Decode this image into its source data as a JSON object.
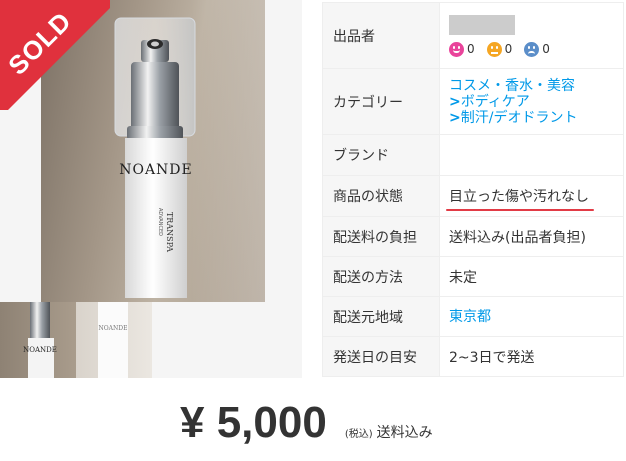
{
  "gallery": {
    "sold_badge": "SOLD",
    "bottle_brand": "NOANDE",
    "bottle_sub1": "ADVANCED",
    "bottle_sub2": "TRANSPA",
    "thumbnail_count": 2
  },
  "details": {
    "seller_label": "出品者",
    "ratings": {
      "good": "0",
      "normal": "0",
      "bad": "0"
    },
    "category_label": "カテゴリー",
    "category_links": [
      "コスメ・香水・美容",
      "ボディケア",
      "制汗/デオドラント"
    ],
    "brand_label": "ブランド",
    "brand_value": "",
    "condition_label": "商品の状態",
    "condition_value": "目立った傷や汚れなし",
    "shipping_fee_label": "配送料の負担",
    "shipping_fee_value": "送料込み(出品者負担)",
    "shipping_method_label": "配送の方法",
    "shipping_method_value": "未定",
    "ship_from_label": "配送元地域",
    "ship_from_value": "東京都",
    "ship_days_label": "発送日の目安",
    "ship_days_value": "2~3日で発送"
  },
  "price": {
    "amount": "¥ 5,000",
    "tax_note": "(税込)",
    "shipping_note": "送料込み"
  },
  "colors": {
    "sold_red": "#e0313d",
    "link_blue": "#0099e8",
    "good": "#e9449b",
    "normal": "#f5a623",
    "bad": "#5b8ec9"
  }
}
